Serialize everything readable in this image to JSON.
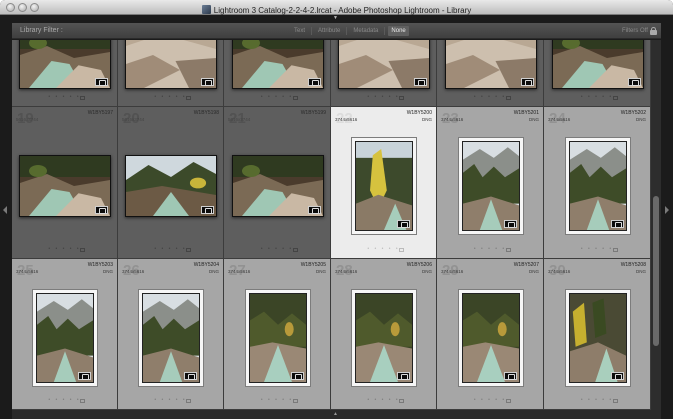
{
  "window": {
    "title": "Lightroom 3 Catalog-2-2-4-2.lrcat - Adobe Photoshop Lightroom - Library"
  },
  "filter_bar": {
    "label": "Library Filter :",
    "tabs": [
      {
        "label": "Text",
        "active": false
      },
      {
        "label": "Attribute",
        "active": false
      },
      {
        "label": "Metadata",
        "active": false
      },
      {
        "label": "None",
        "active": true
      }
    ],
    "status": "Filters Off"
  },
  "grid": {
    "rating_dots": "• • • • •",
    "cells": [
      {
        "index": "",
        "name": "",
        "dims": "",
        "ext": "",
        "state": "dark",
        "orient": "landscape",
        "scene": "cascade",
        "top": true
      },
      {
        "index": "",
        "name": "",
        "dims": "",
        "ext": "",
        "state": "dark",
        "orient": "landscape",
        "scene": "rocks",
        "top": true
      },
      {
        "index": "",
        "name": "",
        "dims": "",
        "ext": "",
        "state": "dark",
        "orient": "landscape",
        "scene": "cascade",
        "top": true
      },
      {
        "index": "",
        "name": "",
        "dims": "",
        "ext": "",
        "state": "dark",
        "orient": "landscape",
        "scene": "rocks",
        "top": true
      },
      {
        "index": "",
        "name": "",
        "dims": "",
        "ext": "",
        "state": "dark",
        "orient": "landscape",
        "scene": "rocks",
        "top": true
      },
      {
        "index": "",
        "name": "",
        "dims": "",
        "ext": "",
        "state": "dark",
        "orient": "landscape",
        "scene": "cascade",
        "top": true
      },
      {
        "index": "19",
        "name": "W1BY5197",
        "dims": "5616x3744",
        "ext": "",
        "state": "dark",
        "orient": "landscape",
        "scene": "cascade"
      },
      {
        "index": "20",
        "name": "W1BY5198",
        "dims": "5616x3744",
        "ext": "",
        "state": "dark",
        "orient": "landscape",
        "scene": "forest"
      },
      {
        "index": "21",
        "name": "W1BY5199",
        "dims": "5616x3744",
        "ext": "",
        "state": "dark",
        "orient": "landscape",
        "scene": "cascade"
      },
      {
        "index": "22",
        "name": "W1BY5200",
        "dims": "3744x5616",
        "ext": "DNG",
        "state": "sel",
        "orient": "portrait",
        "scene": "aspen"
      },
      {
        "index": "23",
        "name": "W1BY5201",
        "dims": "3744x5616",
        "ext": "DNG",
        "state": "light",
        "orient": "portrait",
        "scene": "mountain"
      },
      {
        "index": "24",
        "name": "W1BY5202",
        "dims": "3744x5616",
        "ext": "DNG",
        "state": "light",
        "orient": "portrait",
        "scene": "mountain"
      },
      {
        "index": "25",
        "name": "W1BY5203",
        "dims": "3744x5616",
        "ext": "DNG",
        "state": "light",
        "orient": "portrait",
        "scene": "mountain"
      },
      {
        "index": "26",
        "name": "W1BY5204",
        "dims": "3744x5616",
        "ext": "DNG",
        "state": "light",
        "orient": "portrait",
        "scene": "mountain"
      },
      {
        "index": "27",
        "name": "W1BY5205",
        "dims": "3744x5616",
        "ext": "DNG",
        "state": "light",
        "orient": "portrait",
        "scene": "stream"
      },
      {
        "index": "28",
        "name": "W1BY5206",
        "dims": "3744x5616",
        "ext": "DNG",
        "state": "light",
        "orient": "portrait",
        "scene": "stream"
      },
      {
        "index": "29",
        "name": "W1BY5207",
        "dims": "3744x5616",
        "ext": "DNG",
        "state": "light",
        "orient": "portrait",
        "scene": "stream"
      },
      {
        "index": "30",
        "name": "W1BY5208",
        "dims": "3744x5616",
        "ext": "DNG",
        "state": "light",
        "orient": "portrait",
        "scene": "aspen2"
      }
    ]
  },
  "colors": {
    "dark_cell": "#5e5e5e",
    "light_cell": "#a6a6a6",
    "selected_cell": "#ececec"
  }
}
